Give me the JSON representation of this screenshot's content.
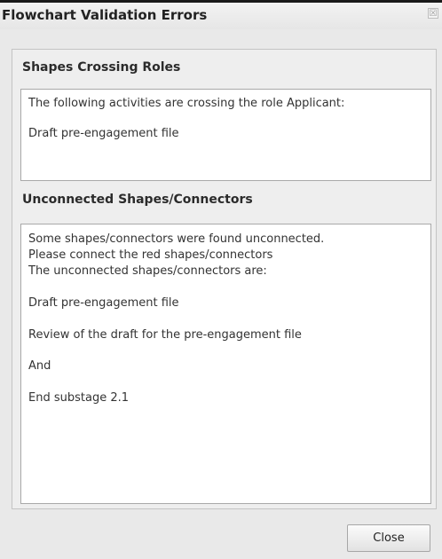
{
  "dialog": {
    "title": "Flowchart Validation Errors",
    "close_icon_glyph": "☒"
  },
  "sections": {
    "crossing": {
      "heading": "Shapes Crossing Roles",
      "lines": [
        "The following activities are crossing the role Applicant:",
        "Draft pre-engagement file"
      ]
    },
    "unconnected": {
      "heading": "Unconnected Shapes/Connectors",
      "lines": [
        "Some shapes/connectors were found unconnected.",
        "Please connect the red shapes/connectors",
        "The unconnected shapes/connectors are:",
        "Draft pre-engagement file",
        "Review of the draft for the pre-engagement file",
        "And",
        "End substage 2.1"
      ]
    }
  },
  "footer": {
    "close_label": "Close"
  }
}
